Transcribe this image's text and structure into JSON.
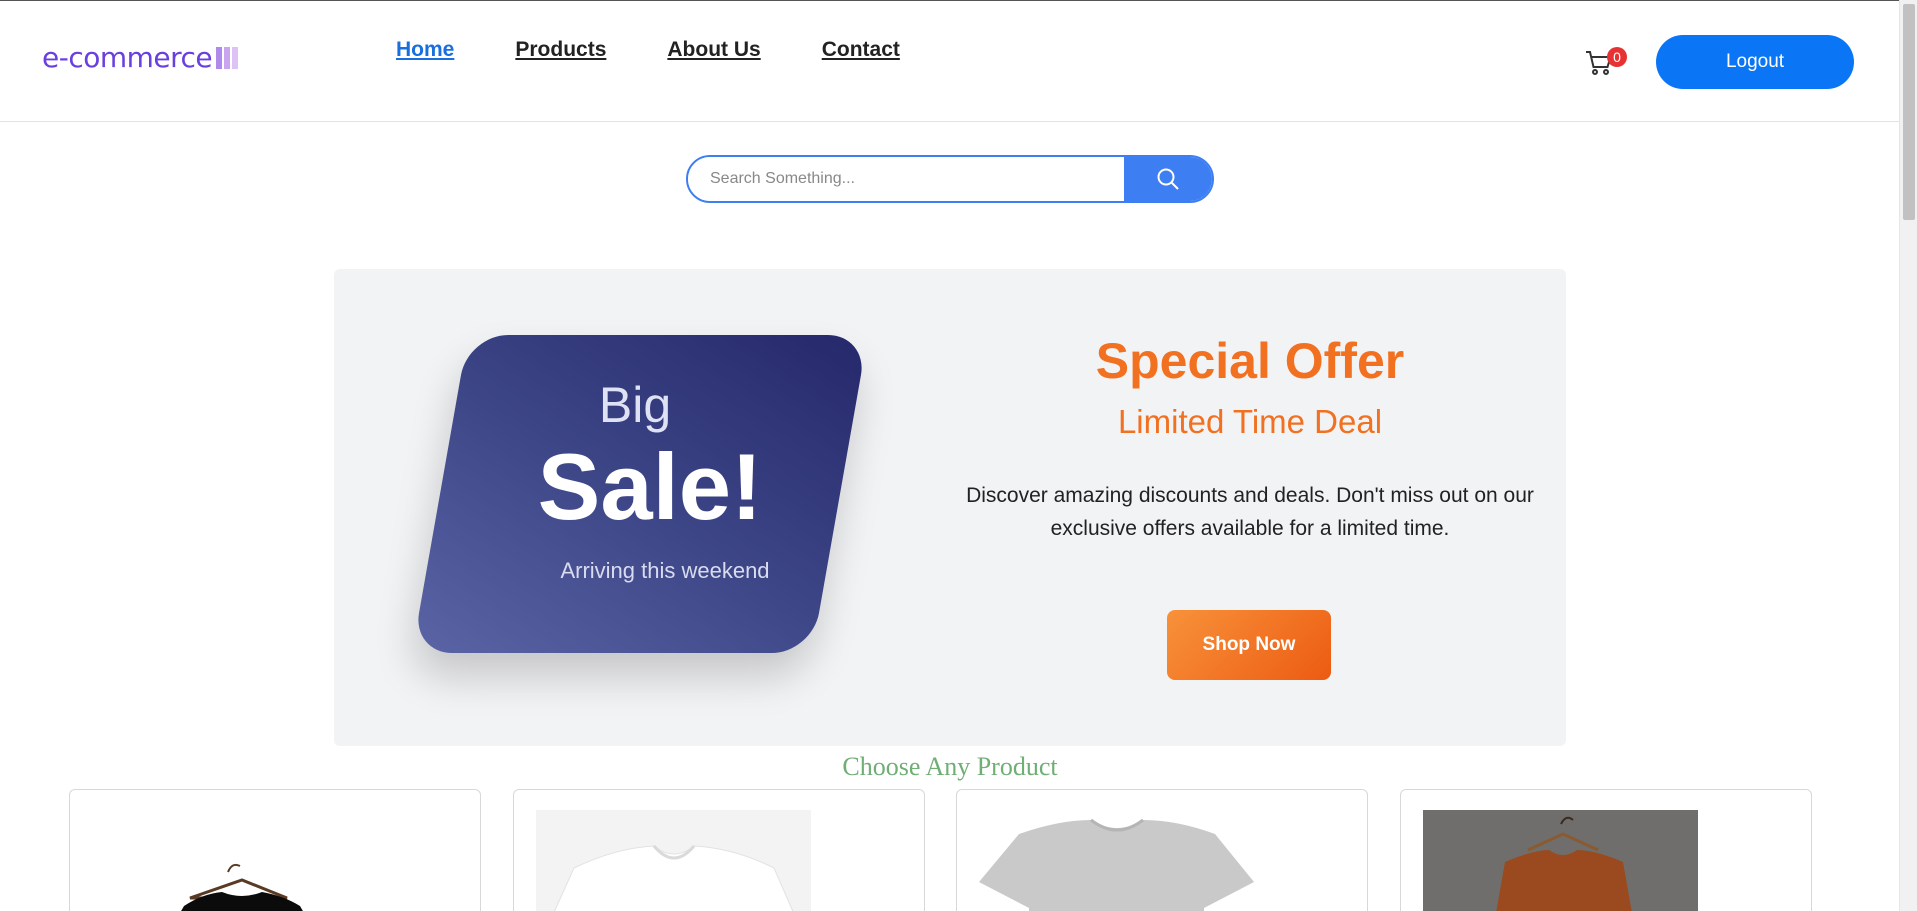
{
  "brand": {
    "logo_text": "e-commerce",
    "logo_color": "#6a3fe0",
    "logo_bar_colors": [
      "#b08ae8",
      "#c9a6ef",
      "#dcc2f5"
    ]
  },
  "nav": {
    "items": [
      {
        "label": "Home",
        "active": true
      },
      {
        "label": "Products",
        "active": false
      },
      {
        "label": "About Us",
        "active": false
      },
      {
        "label": "Contact",
        "active": false
      }
    ]
  },
  "cart": {
    "icon": "cart-icon",
    "count": "0"
  },
  "header": {
    "logout_label": "Logout"
  },
  "search": {
    "placeholder": "Search Something...",
    "value": "",
    "icon": "search-icon"
  },
  "promo": {
    "sale_big": "Big",
    "sale_main": "Sale!",
    "sale_sub": "Arriving this weekend",
    "offer_title": "Special Offer",
    "offer_subtitle": "Limited Time Deal",
    "offer_description": "Discover amazing discounts and deals. Don't miss out on our exclusive offers available for a limited time.",
    "cta_label": "Shop Now"
  },
  "products": {
    "section_title": "Choose Any Product",
    "items": [
      {
        "image": "black t-shirt on hanger"
      },
      {
        "image": "white t-shirt"
      },
      {
        "image": "grey t-shirt"
      },
      {
        "image": "brown t-shirt on hanger"
      }
    ]
  },
  "colors": {
    "primary": "#0a76f6",
    "search_accent": "#3d7ff2",
    "offer_orange": "#f27121",
    "badge_red": "#e63232",
    "section_title_green": "#6fae74"
  }
}
